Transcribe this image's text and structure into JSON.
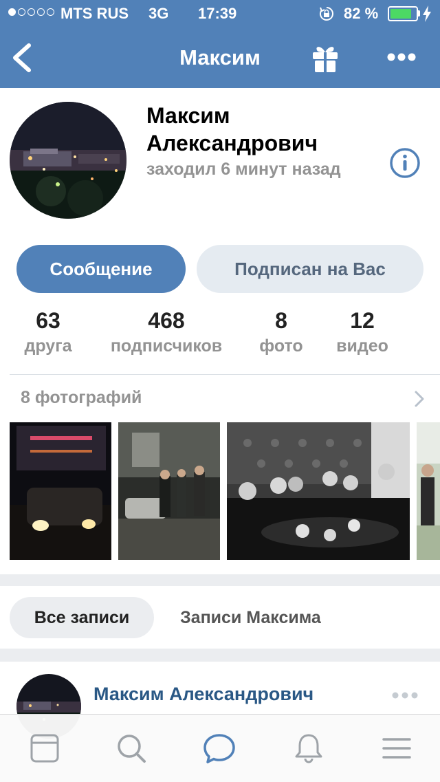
{
  "status_bar": {
    "carrier": "MTS RUS",
    "network": "3G",
    "time": "17:39",
    "battery_percent": "82 %",
    "battery_level": 0.82,
    "signal_bars_filled": 1
  },
  "nav": {
    "title": "Максим",
    "back_icon": "chevron-left-icon",
    "gift_icon": "gift-icon",
    "more_icon": "more-icon"
  },
  "profile": {
    "name": "Максим Александрович",
    "last_seen": "заходил 6 минут назад",
    "info_icon": "info-icon",
    "message_button": "Сообщение",
    "subscribed_button": "Подписан на Вас",
    "counters": [
      {
        "value": "63",
        "label": "друга"
      },
      {
        "value": "468",
        "label": "подписчиков"
      },
      {
        "value": "8",
        "label": "фото"
      },
      {
        "value": "12",
        "label": "видео"
      }
    ]
  },
  "photos": {
    "header": "8 фотографий",
    "count": 5
  },
  "wall_tabs": {
    "all": "Все записи",
    "own": "Записи Максима"
  },
  "post": {
    "author": "Максим Александрович"
  },
  "tab_bar": {
    "items": [
      "news-feed-icon",
      "search-icon",
      "messages-icon",
      "notifications-icon",
      "menu-icon"
    ]
  },
  "colors": {
    "accent": "#5181b8",
    "active_tab": "#5181b8",
    "inactive_tab": "#9ea3a8",
    "battery": "#4cd964"
  }
}
